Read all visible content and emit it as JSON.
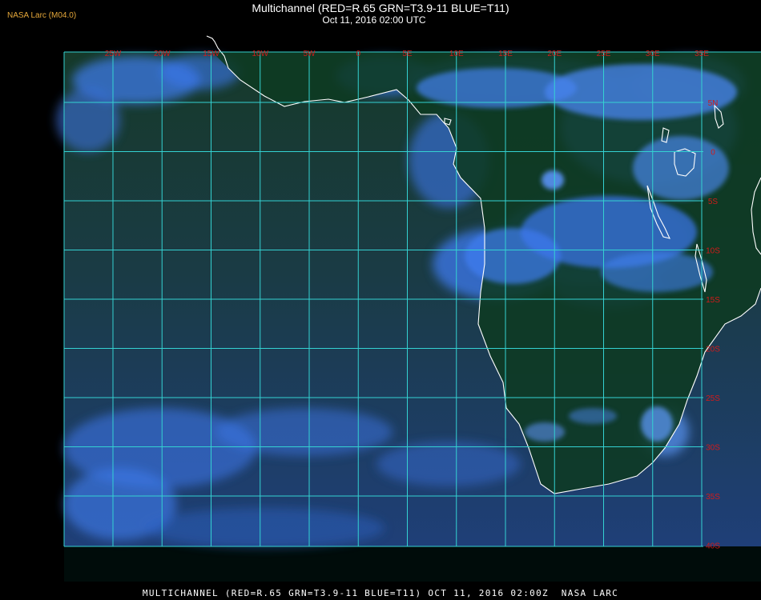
{
  "header": {
    "credit": "NASA Larc (M04.0)",
    "title": "Multichannel (RED=R.65 GRN=T3.9-11 BLUE=T11)",
    "subtitle": "Oct 11, 2016 02:00 UTC"
  },
  "footer": {
    "caption": "MULTICHANNEL (RED=R.65 GRN=T3.9-11 BLUE=T11) OCT 11, 2016 02:00Z  NASA LARC"
  },
  "map": {
    "lon_labels": [
      "25W",
      "20W",
      "15W",
      "10W",
      "5W",
      "0",
      "5E",
      "10E",
      "15E",
      "20E",
      "25E",
      "30E",
      "35E"
    ],
    "lat_labels": [
      "5N",
      "0",
      "5S",
      "10S",
      "15S",
      "20S",
      "25S",
      "30S",
      "35S",
      "40S"
    ],
    "colors": {
      "grid": "#34d2d2",
      "tick_labels": "#d21a1a",
      "coastline": "#ffffff",
      "ocean": "#1b3d3a",
      "cloud": "#3c78f0",
      "land": "#0d2f1f",
      "credit": "#e6a83a"
    }
  }
}
